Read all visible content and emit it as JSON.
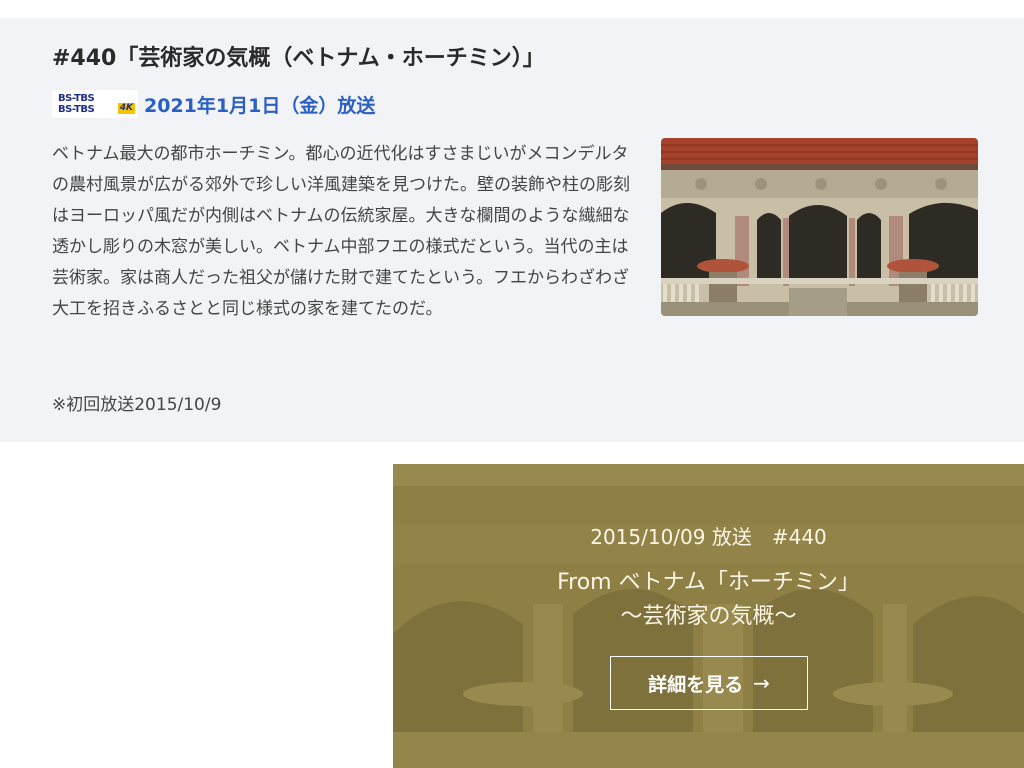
{
  "episode": {
    "title": "#440「芸術家の気概（ベトナム・ホーチミン）」",
    "channel_logo": {
      "line1": "BS-TBS",
      "line2": "BS-TBS",
      "badge": "4K"
    },
    "air_date": "2021年1月1日（金）放送",
    "description": "ベトナム最大の都市ホーチミン。都心の近代化はすさまじいがメコンデルタの農村風景が広がる郊外で珍しい洋風建築を見つけた。壁の装飾や柱の彫刻はヨーロッパ風だが内側はベトナムの伝統家屋。大きな欄間のような繊細な透かし彫りの木窓が美しい。ベトナム中部フエの様式だという。当代の主は芸術家。家は商人だった祖父が儲けた財で建てたという。フエからわざわざ大工を招きふるさとと同じ様式の家を建てたのだ。",
    "first_air": "※初回放送2015/10/9"
  },
  "promo": {
    "date": "2015/10/09 放送　#440",
    "title_line1": "From ベトナム「ホーチミン」",
    "title_line2": "～芸術家の気概～",
    "button_label": "詳細を見る",
    "button_arrow": "→"
  },
  "colors": {
    "panel_bg": "#f2f3f6",
    "air_date": "#2a5fc4",
    "promo_overlay": "#8e7f45"
  }
}
